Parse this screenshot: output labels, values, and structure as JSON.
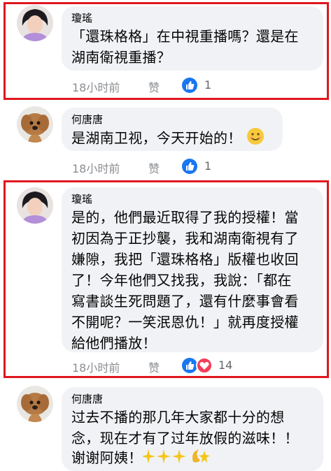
{
  "colors": {
    "highlight": "#e0161f",
    "like": "#1877f2",
    "love": "#f33e58",
    "bubble": "#f0f2f5"
  },
  "comments": [
    {
      "author": "瓊瑤",
      "lines": [
        "「還珠格格」在中視重播嗎？還是在",
        "湖南衛視重播？"
      ],
      "time": "18小时前",
      "like_label": "赞",
      "reaction_count": "1"
    },
    {
      "author": "何唐唐",
      "lines": [
        "是湖南卫视，今天开始的！"
      ],
      "time": "18小时前",
      "like_label": "赞",
      "reaction_count": "1"
    },
    {
      "author": "瓊瑤",
      "lines": [
        "是的，他們最近取得了我的授權！當",
        "初因為于正抄襲，我和湖南衛視有了",
        "嫌隙，我把「還珠格格」版權也收回",
        "了！今年他們又找我，我說：「都在",
        "寫書談生死問題了，還有什麼事會看",
        "不開呢？一笑泯恩仇！」就再度授權",
        "給他們播放！"
      ],
      "time": "18小时前",
      "like_label": "赞",
      "reaction_count": "14"
    },
    {
      "author": "何唐唐",
      "lines": [
        "过去不播的那几年大家都十分的想",
        "念，现在才有了过年放假的滋味！！",
        "谢谢阿姨！"
      ],
      "time": "",
      "like_label": "",
      "reaction_count": ""
    }
  ]
}
